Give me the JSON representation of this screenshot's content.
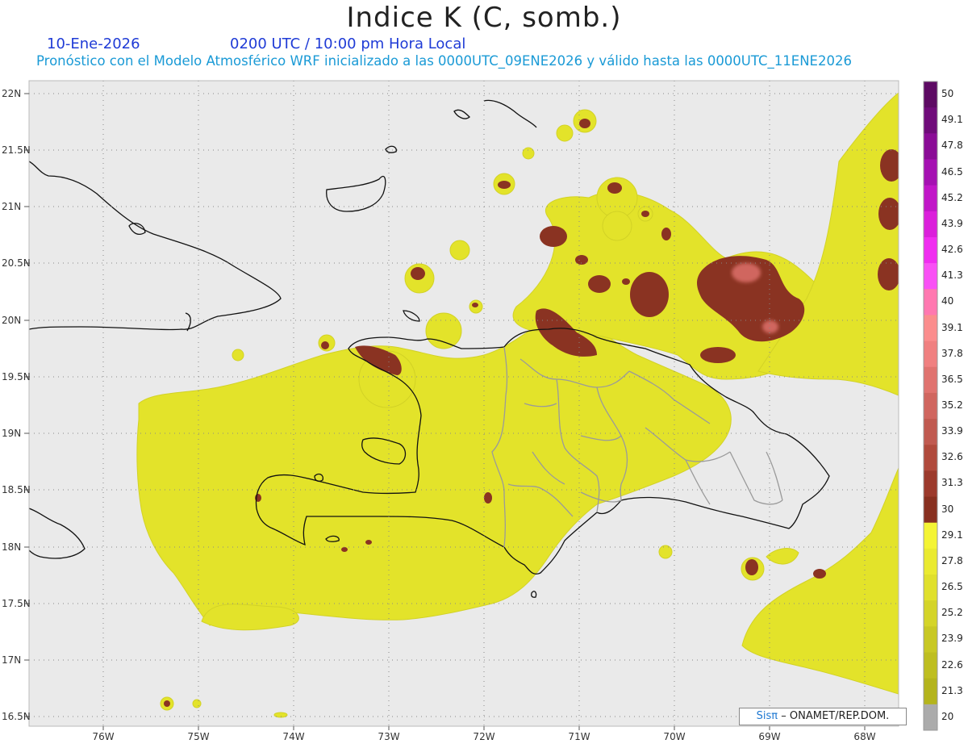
{
  "header": {
    "title": "Indice K (C, somb.)",
    "date": "10-Ene-2026",
    "time": "0200 UTC / 10:00 pm Hora Local",
    "subtitle": "Pronóstico con el Modelo Atmosférico WRF inicializado a las 0000UTC_09ENE2026 y válido hasta las  0000UTC_11ENE2026"
  },
  "map_data": {
    "lon_range": [
      -76.6,
      -67.6
    ],
    "lat_range": [
      6.4,
      22.05
    ],
    "lat_ticks": [
      "22N",
      "21.5N",
      "21N",
      "20.5N",
      "20N",
      "19.5N",
      "19N",
      "18.5N",
      "18N",
      "17.5N",
      "17N",
      "16.5N"
    ],
    "lon_ticks": [
      "76W",
      "75W",
      "74W",
      "73W",
      "72W",
      "71W",
      "70W",
      "69W",
      "68W"
    ],
    "grid": true
  },
  "colorbar": {
    "labels": [
      "50",
      "49.1",
      "47.8",
      "46.5",
      "45.2",
      "43.9",
      "42.6",
      "41.3",
      "40",
      "39.1",
      "37.8",
      "36.5",
      "35.2",
      "33.9",
      "32.6",
      "31.3",
      "30",
      "29.1",
      "27.8",
      "26.5",
      "25.2",
      "23.9",
      "22.6",
      "21.3",
      "20"
    ],
    "colors": [
      "#5d0a63",
      "#6f0b7a",
      "#8a0c96",
      "#a511b2",
      "#c116c8",
      "#db1fdb",
      "#f02df0",
      "#f950f5",
      "#ff78b0",
      "#fb8d8d",
      "#f08080",
      "#e0736f",
      "#d0665f",
      "#c05a50",
      "#b04a3c",
      "#9c3a2c",
      "#883020",
      "#f4f434",
      "#eaea30",
      "#e0e02c",
      "#d4d428",
      "#c8c824",
      "#bebe20",
      "#b4b41c",
      "#ababab"
    ]
  },
  "credit": {
    "brand": "Sisπ",
    "org": "– ONAMET/REP.DOM."
  }
}
